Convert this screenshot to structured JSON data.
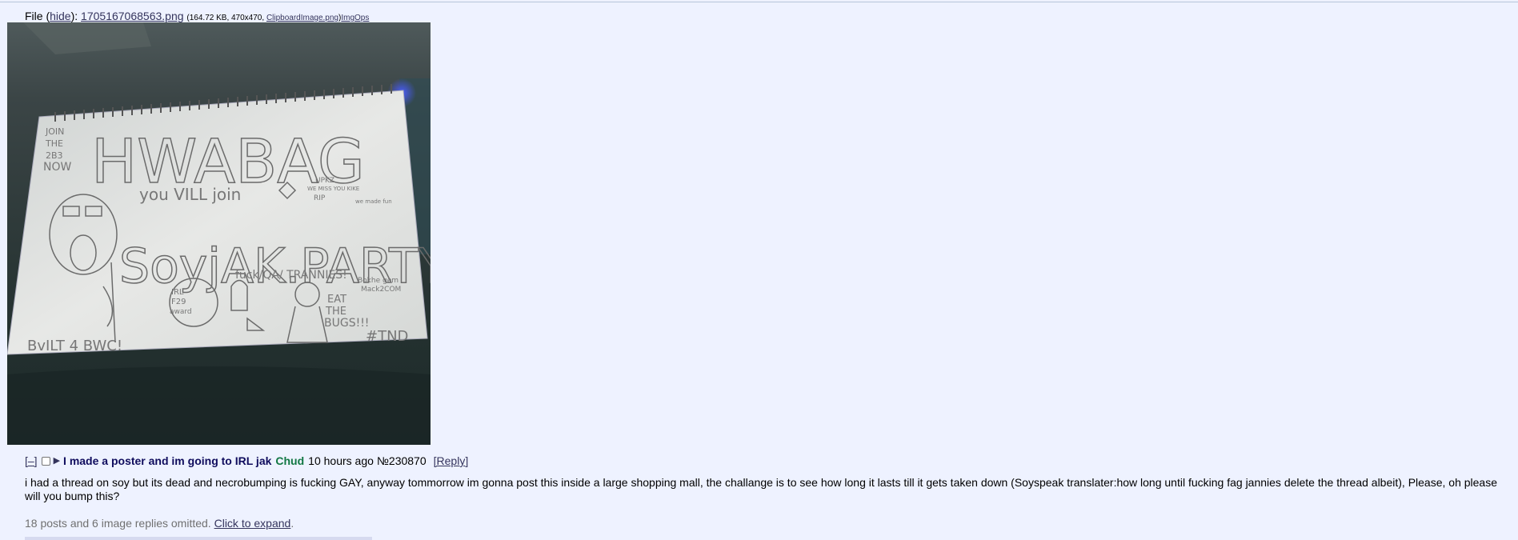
{
  "file": {
    "prefix": "File (",
    "hide_label": "hide",
    "suffix": "):",
    "filename": "1705167068563.png",
    "meta": "(164.72 KB, 470x470,",
    "original_name": "ClipboardImage.png",
    "meta_close": ")",
    "imgops_label": "ImgOps"
  },
  "image": {
    "drawing": {
      "corner_text": [
        "JOIN",
        "THE",
        "2B3",
        "NOW"
      ],
      "big_title": "HWABAG",
      "join_text": "you VILL join",
      "site_text": "SoyjAK.PARTY",
      "side_note": [
        "UPKZ",
        "WE MISS YOU KIKE",
        "RIP",
        "we made fun"
      ],
      "fuck_text": "fuck/QA/ TRANNIES!",
      "irl_text": [
        "IRL",
        "F29",
        "award"
      ],
      "eat_bugs": [
        "EAT",
        "THE",
        "BUGS!!!"
      ],
      "bottom_right_text": [
        "Bokhe gem",
        "Mack2COM"
      ],
      "hashtag": "#TND",
      "built_text": "BvILT 4 BWC!"
    }
  },
  "post": {
    "hide_toggle": "[–]",
    "subject": "I made a poster and im going to IRL jak",
    "name": "Chud",
    "time": "10 hours ago",
    "number": "№230870",
    "reply_label": "[Reply]",
    "body": "i had a thread on soy but its dead and necrobumping is fucking GAY, anyway tommorrow im gonna post this inside a large shopping mall, the challange is to see how long it lasts till it gets taken down (Soyspeak translater:how long until fucking fag jannies delete the thread albeit), Please, oh please will you bump this?"
  },
  "omitted": {
    "text": "18 posts and 6 image replies omitted.",
    "expand_label": "Click to expand",
    "period": "."
  },
  "colors": {
    "background": "#eef2ff",
    "link": "#34345c",
    "subject": "#0f0c5d",
    "name": "#117743",
    "omitted": "#707070"
  }
}
